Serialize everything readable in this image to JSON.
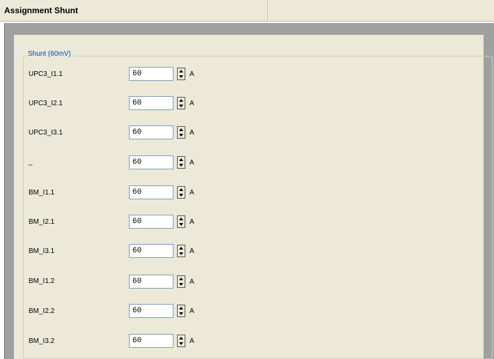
{
  "header": {
    "title": "Assignment Shunt"
  },
  "group": {
    "title": "Shunt (60mV)"
  },
  "rows": [
    {
      "label": "UPC3_I1.1",
      "value": "60",
      "unit": "A"
    },
    {
      "label": "UPC3_I2.1",
      "value": "60",
      "unit": "A"
    },
    {
      "label": "UPC3_I3.1",
      "value": "60",
      "unit": "A"
    },
    {
      "label": "_",
      "value": "60",
      "unit": "A"
    },
    {
      "label": "BM_I1.1",
      "value": "60",
      "unit": "A"
    },
    {
      "label": "BM_I2.1",
      "value": "60",
      "unit": "A"
    },
    {
      "label": "BM_I3.1",
      "value": "60",
      "unit": "A"
    },
    {
      "label": "BM_I1.2",
      "value": "60",
      "unit": "A"
    },
    {
      "label": "BM_I2.2",
      "value": "60",
      "unit": "A"
    },
    {
      "label": "BM_I3.2",
      "value": "60",
      "unit": "A"
    }
  ]
}
